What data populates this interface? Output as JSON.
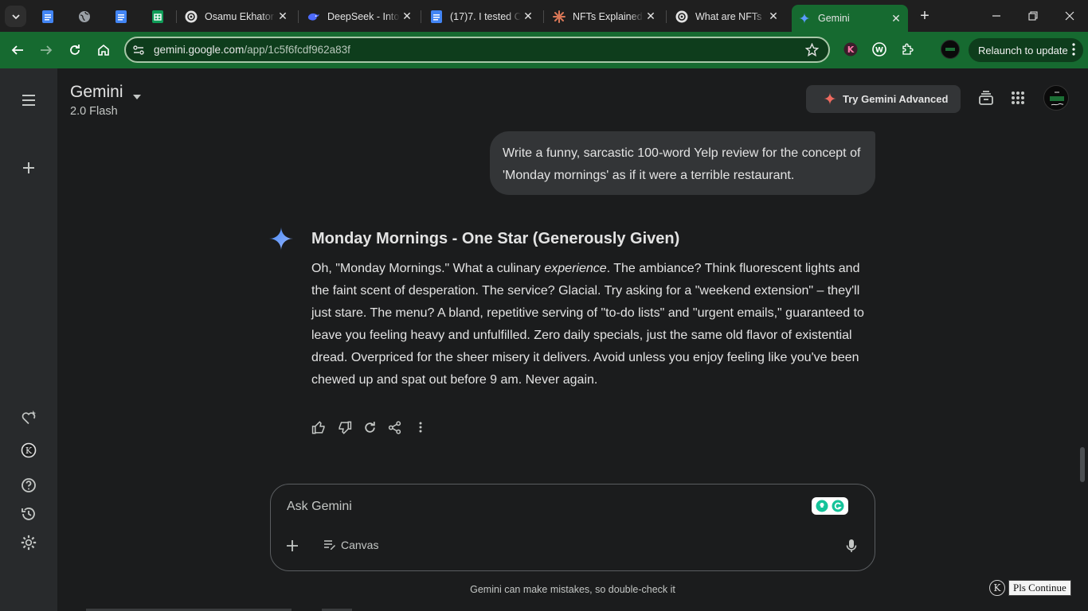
{
  "browser": {
    "tabs": [
      {
        "title": "",
        "icon": "google-docs-icon"
      },
      {
        "title": "",
        "icon": "globe-icon"
      },
      {
        "title": "",
        "icon": "google-docs-icon"
      },
      {
        "title": "",
        "icon": "google-sheets-icon"
      },
      {
        "title": "Osamu Ekhator",
        "icon": "chatgpt-icon"
      },
      {
        "title": "DeepSeek - Into",
        "icon": "deepseek-icon"
      },
      {
        "title": "(17)7. I tested C",
        "icon": "google-docs-icon"
      },
      {
        "title": "NFTs Explained",
        "icon": "claude-icon"
      },
      {
        "title": "What are NFTs",
        "icon": "chatgpt-icon"
      },
      {
        "title": "Gemini",
        "icon": "gemini-icon"
      }
    ],
    "url_host": "gemini.google.com",
    "url_path": "/app/1c5f6fcdf962a83f",
    "relaunch_label": "Relaunch to update"
  },
  "header": {
    "app_title": "Gemini",
    "model": "2.0 Flash",
    "try_advanced": "Try Gemini Advanced"
  },
  "conversation": {
    "user_prompt": "Write a funny, sarcastic 100-word Yelp review for the concept of 'Monday mornings' as if it were a terrible restaurant.",
    "response_title": "Monday Mornings - One Star (Generously Given)",
    "response_p1": "Oh, \"Monday Mornings.\" What a culinary ",
    "response_em": "experience",
    "response_p2": ". The ambiance? Think fluorescent lights and the faint scent of desperation. The service? Glacial. Try asking for a \"weekend extension\" – they'll just stare. The menu? A bland, repetitive serving of \"to-do lists\" and \"urgent emails,\" guaranteed to leave you feeling heavy and unfulfilled. Zero daily specials, just the same old flavor of existential dread. Overpriced for the sheer misery it delivers. Avoid unless you enjoy feeling like you've been chewed up and spat out before 9 am. Never again."
  },
  "composer": {
    "placeholder": "Ask Gemini",
    "canvas_label": "Canvas"
  },
  "footer": {
    "disclaimer": "Gemini can make mistakes, so double-check it",
    "pls_continue": "Pls Continue",
    "k_badge": "K"
  },
  "colors": {
    "accent_green": "#166a30",
    "page_bg": "#1b1c1d",
    "sidebar_bg": "#282a2c",
    "bubble_bg": "#333537",
    "gemini_blue": "#4b90ff"
  }
}
